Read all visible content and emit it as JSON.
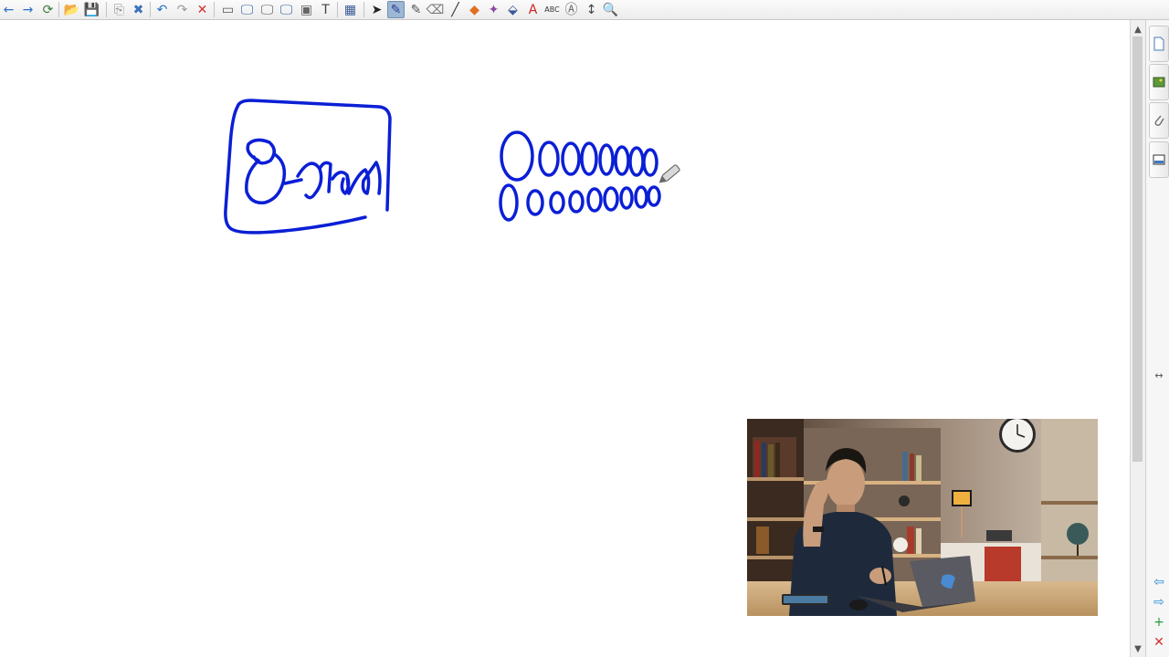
{
  "toolbar": {
    "buttons": [
      {
        "name": "back-arrow-icon",
        "glyph": "←",
        "color": "#2a6fc9"
      },
      {
        "name": "forward-arrow-icon",
        "glyph": "→",
        "color": "#2a6fc9"
      },
      {
        "name": "add-page-icon",
        "glyph": "⟳",
        "color": "#3a7a3a"
      },
      {
        "name": "open-folder-icon",
        "glyph": "📂",
        "color": "#d89a2a"
      },
      {
        "name": "save-icon",
        "glyph": "💾",
        "color": "#3a5a9a"
      },
      {
        "name": "paste-icon",
        "glyph": "⎘",
        "color": "#8a8a8a"
      },
      {
        "name": "clear-page-icon",
        "glyph": "✖",
        "color": "#3a73b9"
      },
      {
        "name": "undo-icon",
        "glyph": "↶",
        "color": "#2a6fc9"
      },
      {
        "name": "redo-icon",
        "glyph": "↷",
        "color": "#9a9a9a"
      },
      {
        "name": "delete-icon",
        "glyph": "✕",
        "color": "#d03030"
      },
      {
        "name": "screen-shade-icon",
        "glyph": "▭",
        "color": "#555555"
      },
      {
        "name": "display-icon",
        "glyph": "🖵",
        "color": "#2a5fa0"
      },
      {
        "name": "full-screen-icon",
        "glyph": "🖵",
        "color": "#555555"
      },
      {
        "name": "dual-display-icon",
        "glyph": "🖵",
        "color": "#2a5fa0"
      },
      {
        "name": "screen-capture-icon",
        "glyph": "▣",
        "color": "#666666"
      },
      {
        "name": "text-tool-icon",
        "glyph": "T",
        "color": "#444444"
      },
      {
        "name": "table-icon",
        "glyph": "▦",
        "color": "#3a5a9a"
      },
      {
        "name": "select-pointer-icon",
        "glyph": "➤",
        "color": "#222222"
      },
      {
        "name": "pen-icon",
        "glyph": "✎",
        "color": "#2a3fa0"
      },
      {
        "name": "creative-pen-icon",
        "glyph": "✎",
        "color": "#555555"
      },
      {
        "name": "eraser-icon",
        "glyph": "⌫",
        "color": "#777777"
      },
      {
        "name": "line-icon",
        "glyph": "╱",
        "color": "#333333"
      },
      {
        "name": "shapes-icon",
        "glyph": "◆",
        "color": "#e07020"
      },
      {
        "name": "magic-pen-icon",
        "glyph": "✦",
        "color": "#8a4aa0"
      },
      {
        "name": "fill-icon",
        "glyph": "⬙",
        "color": "#3a5a9a"
      },
      {
        "name": "text-color-icon",
        "glyph": "A",
        "color": "#d02020"
      },
      {
        "name": "properties-icon",
        "glyph": "ABC",
        "color": "#333333"
      },
      {
        "name": "handwriting-icon",
        "glyph": "Ⓐ",
        "color": "#666666"
      },
      {
        "name": "move-toolbar-icon",
        "glyph": "↕",
        "color": "#444444"
      },
      {
        "name": "zoom-icon",
        "glyph": "🔍",
        "color": "#555555"
      }
    ]
  },
  "canvas": {
    "ink_color": "#0b1fd6",
    "background": "#ffffff"
  },
  "side_panel": {
    "tabs": [
      {
        "name": "page-sorter-tab-icon"
      },
      {
        "name": "gallery-tab-icon"
      },
      {
        "name": "attachments-tab-icon"
      },
      {
        "name": "properties-tab-icon"
      }
    ],
    "bottom": [
      {
        "name": "previous-page-icon",
        "glyph": "⇦",
        "color": "#2a8fd6"
      },
      {
        "name": "next-page-icon",
        "glyph": "⇨",
        "color": "#2a8fd6"
      },
      {
        "name": "add-page-side-icon",
        "glyph": "+",
        "color": "#2a9a3a"
      },
      {
        "name": "delete-page-side-icon",
        "glyph": "✕",
        "color": "#d03030"
      }
    ],
    "resize_glyph": "↔"
  },
  "scrollbar": {
    "up_glyph": "▲",
    "down_glyph": "▼"
  },
  "video_overlay": {
    "description_icon": "presenter-video-feed"
  }
}
